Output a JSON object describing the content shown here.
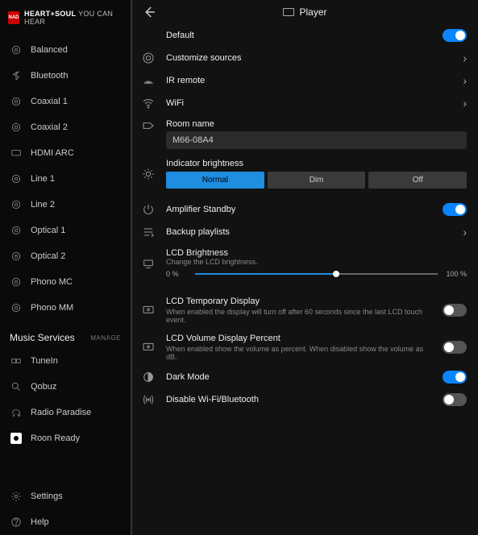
{
  "brand": {
    "logo_text": "NAD",
    "line1": "HEART+SOUL",
    "line2": "YOU CAN HEAR"
  },
  "sidebar": {
    "inputs": [
      {
        "label": "Balanced",
        "icon": "circle"
      },
      {
        "label": "Bluetooth",
        "icon": "bluetooth"
      },
      {
        "label": "Coaxial 1",
        "icon": "circle"
      },
      {
        "label": "Coaxial 2",
        "icon": "circle"
      },
      {
        "label": "HDMI ARC",
        "icon": "display"
      },
      {
        "label": "Line 1",
        "icon": "circle"
      },
      {
        "label": "Line 2",
        "icon": "circle"
      },
      {
        "label": "Optical 1",
        "icon": "circle"
      },
      {
        "label": "Optical 2",
        "icon": "circle"
      },
      {
        "label": "Phono MC",
        "icon": "circle"
      },
      {
        "label": "Phono MM",
        "icon": "circle"
      }
    ],
    "services_header": "Music Services",
    "manage_label": "MANAGE",
    "services": [
      {
        "label": "TuneIn",
        "icon": "tunein"
      },
      {
        "label": "Qobuz",
        "icon": "search"
      },
      {
        "label": "Radio Paradise",
        "icon": "headphones"
      },
      {
        "label": "Roon Ready",
        "icon": "roon"
      }
    ],
    "footer": [
      {
        "label": "Settings",
        "icon": "gear"
      },
      {
        "label": "Help",
        "icon": "help"
      }
    ]
  },
  "header": {
    "title": "Player"
  },
  "rows": {
    "default": {
      "label": "Default",
      "on": true
    },
    "customize": {
      "label": "Customize sources"
    },
    "ir": {
      "label": "IR remote"
    },
    "wifi": {
      "label": "WiFi"
    },
    "room": {
      "label": "Room name",
      "value": "M66-08A4"
    },
    "indicator": {
      "label": "Indicator brightness",
      "options": [
        "Normal",
        "Dim",
        "Off"
      ],
      "active": 0
    },
    "amp": {
      "label": "Amplifier Standby",
      "on": true
    },
    "backup": {
      "label": "Backup playlists"
    },
    "lcd": {
      "label": "LCD Brightness",
      "sub": "Change the LCD brightness.",
      "min_label": "0 %",
      "max_label": "100 %",
      "value_pct": 58
    },
    "lcd_temp": {
      "label": "LCD Temporary Display",
      "sub": "When enabled the display will turn off after 60 seconds since the last LCD touch event.",
      "on": false
    },
    "lcd_vol": {
      "label": "LCD Volume Display Percent",
      "sub": "When enabled show the volume as percent.  When disabled show the volume as dB.",
      "on": false
    },
    "dark": {
      "label": "Dark Mode",
      "on": true
    },
    "disable_wifi": {
      "label": "Disable Wi-Fi/Bluetooth",
      "on": false
    }
  }
}
